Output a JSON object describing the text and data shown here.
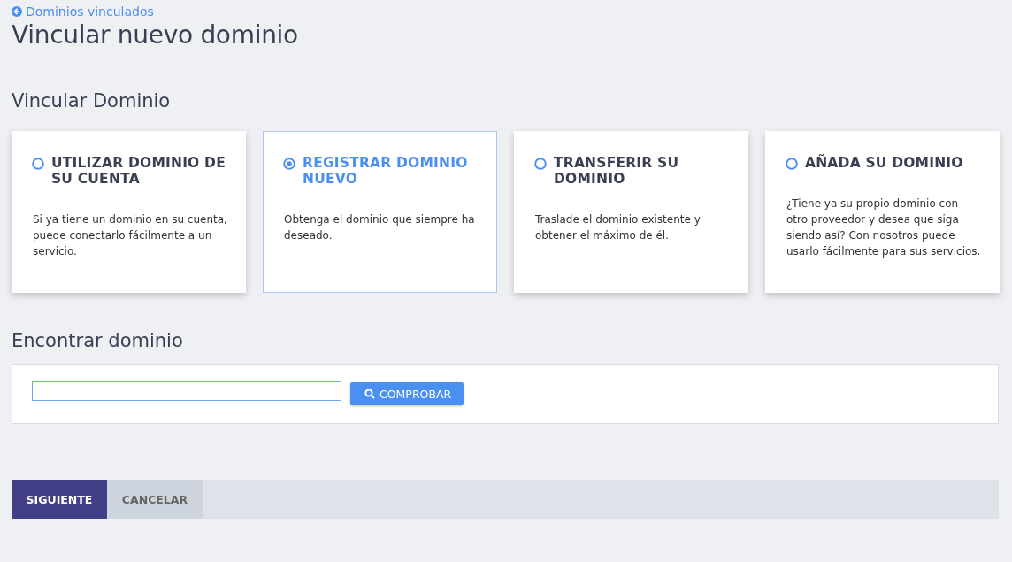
{
  "back_link": {
    "label": "Dominios vinculados"
  },
  "page_title": "Vincular nuevo dominio",
  "link_section": {
    "heading": "Vincular Dominio",
    "options": [
      {
        "title": "UTILIZAR DOMINIO DE SU CUENTA",
        "description": "Si ya tiene un dominio en su cuenta, puede conectarlo fácilmente a un servicio.",
        "selected": false
      },
      {
        "title": "REGISTRAR DOMINIO NUEVO",
        "description": "Obtenga el dominio que siempre ha deseado.",
        "selected": true
      },
      {
        "title": "TRANSFERIR SU DOMINIO",
        "description": "Traslade el dominio existente y obtener el máximo de él.",
        "selected": false
      },
      {
        "title": "AÑADA SU DOMINIO",
        "description": "¿Tiene ya su propio dominio con otro proveedor y desea que siga siendo así? Con nosotros puede usarlo fácilmente para sus servicios.",
        "selected": false
      }
    ]
  },
  "find_section": {
    "heading": "Encontrar dominio",
    "check_button": "COMPROBAR"
  },
  "footer": {
    "buttons": [
      {
        "label": "SIGUIENTE",
        "kind": "primary"
      },
      {
        "label": "CANCELAR",
        "kind": "secondary"
      }
    ]
  }
}
